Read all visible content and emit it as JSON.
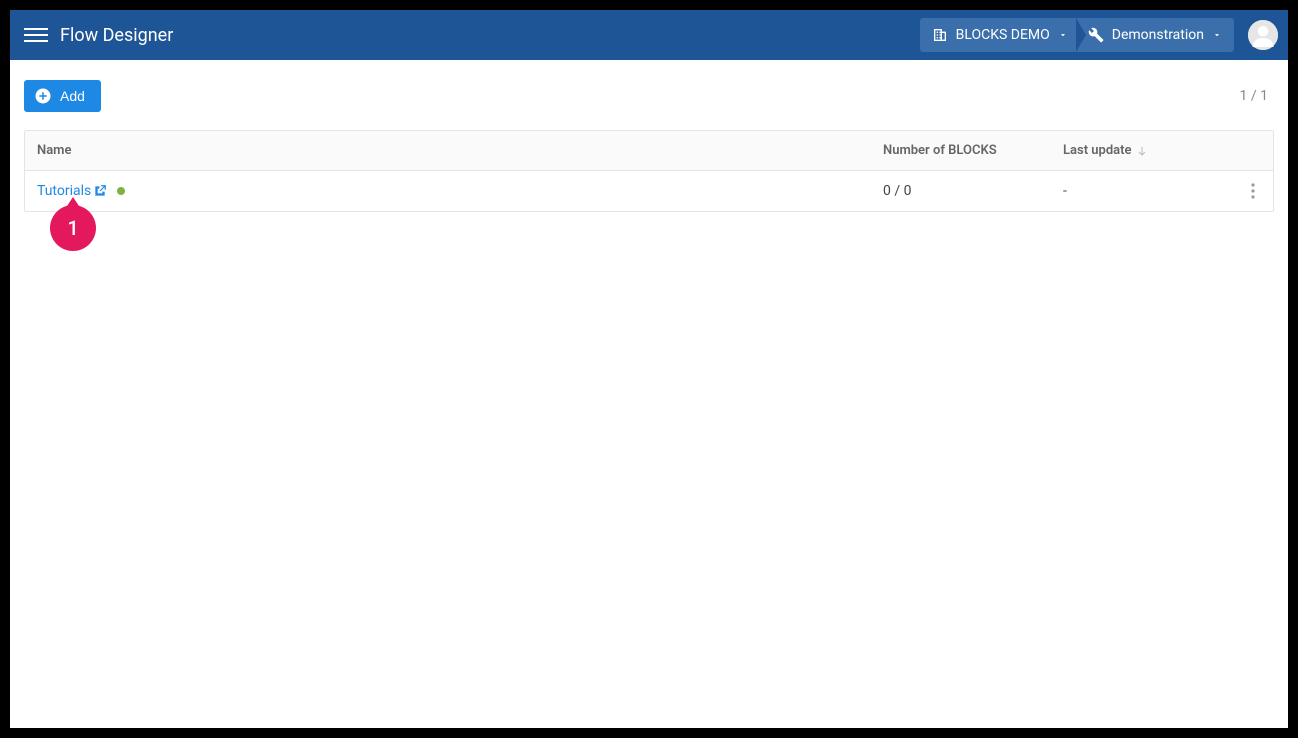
{
  "header": {
    "title": "Flow Designer",
    "breadcrumb": {
      "org": "BLOCKS DEMO",
      "project": "Demonstration"
    }
  },
  "toolbar": {
    "add_label": "Add",
    "page_counter": "1 / 1"
  },
  "table": {
    "headers": {
      "name": "Name",
      "blocks": "Number of BLOCKS",
      "updated": "Last update"
    },
    "rows": [
      {
        "name": "Tutorials",
        "blocks": "0 / 0",
        "updated": "-"
      }
    ]
  },
  "callouts": [
    {
      "num": "1"
    }
  ]
}
